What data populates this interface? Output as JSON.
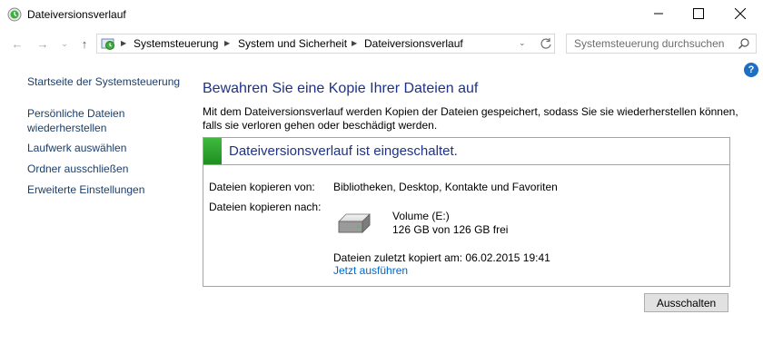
{
  "window": {
    "title": "Dateiversionsverlauf"
  },
  "address": {
    "crumbs": [
      "Systemsteuerung",
      "System und Sicherheit",
      "Dateiversionsverlauf"
    ],
    "search_placeholder": "Systemsteuerung durchsuchen"
  },
  "help": {
    "glyph": "?"
  },
  "sidebar": {
    "items": [
      {
        "label": "Startseite der Systemsteuerung"
      },
      {
        "label_line1": "Persönliche Dateien",
        "label_line2": "wiederherstellen"
      },
      {
        "label": "Laufwerk auswählen"
      },
      {
        "label": "Ordner ausschließen"
      },
      {
        "label": "Erweiterte Einstellungen"
      }
    ]
  },
  "main": {
    "title": "Bewahren Sie eine Kopie Ihrer Dateien auf",
    "description_line1": "Mit dem Dateiversionsverlauf werden Kopien der Dateien gespeichert, sodass Sie sie wiederherstellen können,",
    "description_line2": "falls sie verloren gehen oder beschädigt werden.",
    "status_title": "Dateiversionsverlauf ist eingeschaltet.",
    "copy_from_label": "Dateien kopieren von:",
    "copy_from_value": "Bibliotheken, Desktop, Kontakte und Favoriten",
    "copy_to_label": "Dateien kopieren nach:",
    "drive_name": "Volume (E:)",
    "drive_space": "126 GB von 126 GB frei",
    "last_copy": "Dateien zuletzt kopiert am: 06.02.2015 19:41",
    "run_now_link": "Jetzt ausführen",
    "turn_off_button": "Ausschalten"
  },
  "colors": {
    "accent_title": "#1e3287",
    "link": "#0066cc",
    "status_green": "#2ea82e"
  }
}
